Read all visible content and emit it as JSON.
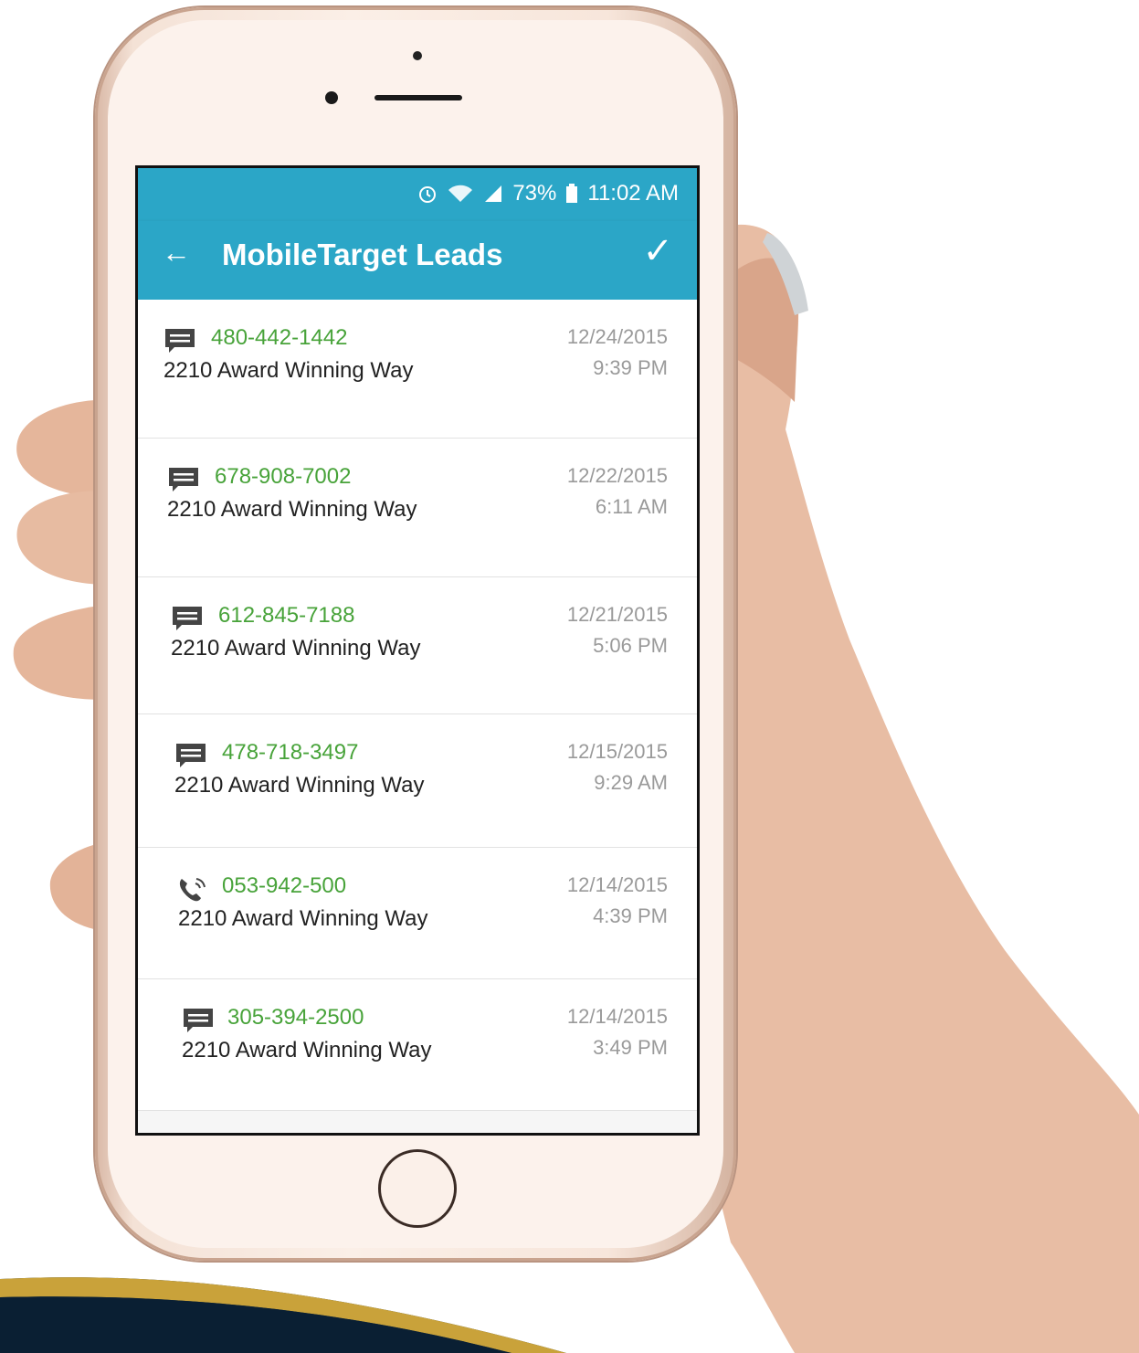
{
  "status": {
    "battery": "73%",
    "time": "11:02 AM"
  },
  "appbar": {
    "title": "MobileTarget Leads"
  },
  "colors": {
    "header": "#2ba6c7",
    "phone_number": "#48a33a",
    "timestamp": "#9a9a9a"
  },
  "leads": [
    {
      "icon": "message-icon",
      "phone": "480-442-1442",
      "address": "2210 Award Winning Way",
      "date": "12/24/2015",
      "time": "9:39 PM"
    },
    {
      "icon": "message-icon",
      "phone": "678-908-7002",
      "address": "2210 Award Winning Way",
      "date": "12/22/2015",
      "time": "6:11 AM"
    },
    {
      "icon": "message-icon",
      "phone": "612-845-7188",
      "address": "2210 Award Winning Way",
      "date": "12/21/2015",
      "time": "5:06 PM"
    },
    {
      "icon": "message-icon",
      "phone": "478-718-3497",
      "address": "2210 Award Winning Way",
      "date": "12/15/2015",
      "time": "9:29 AM"
    },
    {
      "icon": "phone-call-icon",
      "phone": "053-942-500",
      "address": "2210 Award Winning Way",
      "date": "12/14/2015",
      "time": "4:39 PM"
    },
    {
      "icon": "message-icon",
      "phone": "305-394-2500",
      "address": "2210 Award Winning Way",
      "date": "12/14/2015",
      "time": "3:49 PM"
    }
  ]
}
